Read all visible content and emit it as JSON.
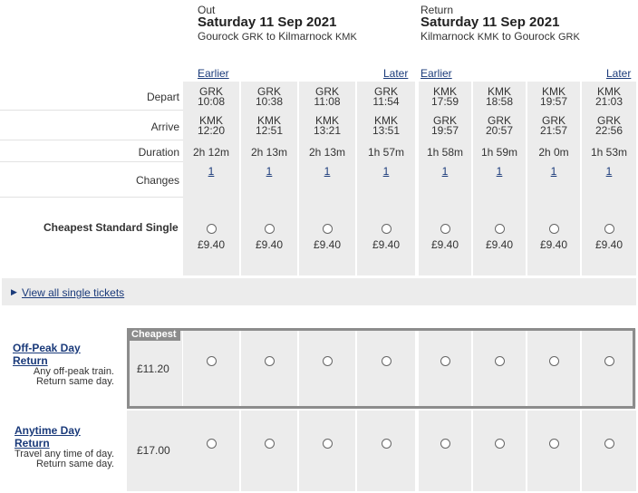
{
  "out": {
    "label": "Out",
    "date": "Saturday 11 Sep 2021",
    "route_from": "Gourock",
    "route_from_code": "GRK",
    "route_to": "Kilmarnock",
    "route_to_code": "KMK"
  },
  "ret": {
    "label": "Return",
    "date": "Saturday 11 Sep 2021",
    "route_from": "Kilmarnock",
    "route_from_code": "KMK",
    "route_to": "Gourock",
    "route_to_code": "GRK"
  },
  "nav": {
    "earlier": "Earlier",
    "later": "Later"
  },
  "row_labels": {
    "depart": "Depart",
    "arrive": "Arrive",
    "duration": "Duration",
    "changes": "Changes",
    "cheapest_single": "Cheapest Standard Single"
  },
  "route_word_to": "to",
  "journeys": [
    {
      "dep_code": "GRK",
      "dep_time": "10:08",
      "arr_code": "KMK",
      "arr_time": "12:20",
      "duration": "2h 12m",
      "changes": "1",
      "price": "£9.40"
    },
    {
      "dep_code": "GRK",
      "dep_time": "10:38",
      "arr_code": "KMK",
      "arr_time": "12:51",
      "duration": "2h 13m",
      "changes": "1",
      "price": "£9.40"
    },
    {
      "dep_code": "GRK",
      "dep_time": "11:08",
      "arr_code": "KMK",
      "arr_time": "13:21",
      "duration": "2h 13m",
      "changes": "1",
      "price": "£9.40"
    },
    {
      "dep_code": "GRK",
      "dep_time": "11:54",
      "arr_code": "KMK",
      "arr_time": "13:51",
      "duration": "1h 57m",
      "changes": "1",
      "price": "£9.40"
    },
    {
      "dep_code": "KMK",
      "dep_time": "17:59",
      "arr_code": "GRK",
      "arr_time": "19:57",
      "duration": "1h 58m",
      "changes": "1",
      "price": "£9.40"
    },
    {
      "dep_code": "KMK",
      "dep_time": "18:58",
      "arr_code": "GRK",
      "arr_time": "20:57",
      "duration": "1h 59m",
      "changes": "1",
      "price": "£9.40"
    },
    {
      "dep_code": "KMK",
      "dep_time": "19:57",
      "arr_code": "GRK",
      "arr_time": "21:57",
      "duration": "2h 0m",
      "changes": "1",
      "price": "£9.40"
    },
    {
      "dep_code": "KMK",
      "dep_time": "21:03",
      "arr_code": "GRK",
      "arr_time": "22:56",
      "duration": "1h 53m",
      "changes": "1",
      "price": "£9.40"
    }
  ],
  "view_all": {
    "arrow": "▶",
    "label": "View all single tickets"
  },
  "returns": [
    {
      "name": "Off-Peak Day Return",
      "desc1": "Any off-peak train.",
      "desc2": "Return same day.",
      "price": "£11.20",
      "badge": "Cheapest"
    },
    {
      "name": "Anytime Day Return",
      "desc1": "Travel any time of day.",
      "desc2": "Return same day.",
      "price": "£17.00",
      "badge": ""
    }
  ],
  "colors": {
    "cell_bg": "#ececec",
    "link": "#1a3a7a",
    "highlight_border": "#8c8c8c"
  }
}
